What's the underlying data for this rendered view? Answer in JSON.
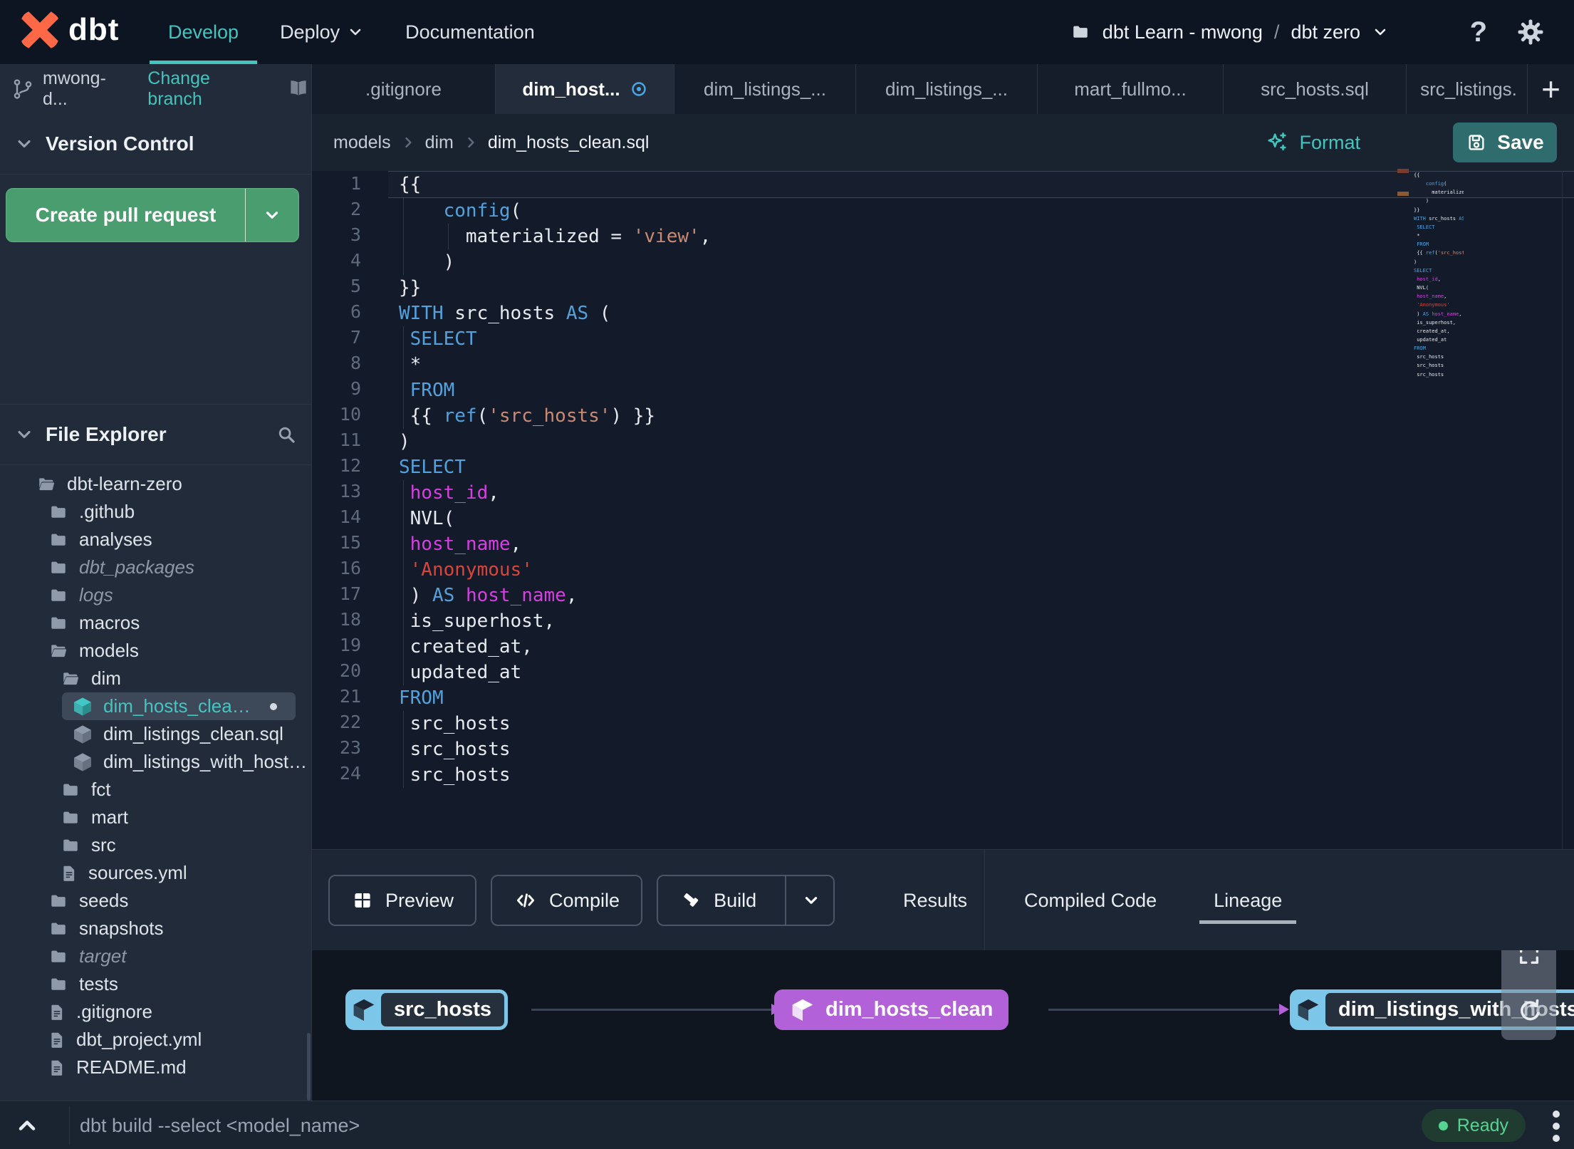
{
  "topnav": {
    "brand": "dbt",
    "items": [
      {
        "label": "Develop",
        "active": true,
        "chevron": false
      },
      {
        "label": "Deploy",
        "active": false,
        "chevron": true
      },
      {
        "label": "Documentation",
        "active": false,
        "chevron": false
      }
    ],
    "project": {
      "name": "dbt Learn - mwong",
      "separator": "/",
      "environment": "dbt zero"
    }
  },
  "branch": {
    "name": "mwong-d...",
    "action": "Change branch"
  },
  "tabs": [
    {
      "label": ".gitignore",
      "active": false,
      "dirty": false
    },
    {
      "label": "dim_host...",
      "active": true,
      "dirty": true
    },
    {
      "label": "dim_listings_...",
      "active": false,
      "dirty": false
    },
    {
      "label": "dim_listings_...",
      "active": false,
      "dirty": false
    },
    {
      "label": "mart_fullmo...",
      "active": false,
      "dirty": false
    },
    {
      "label": "src_hosts.sql",
      "active": false,
      "dirty": false
    },
    {
      "label": "src_listings.",
      "active": false,
      "dirty": false
    }
  ],
  "version_control": {
    "title": "Version Control",
    "create_pr_label": "Create pull request"
  },
  "file_explorer": {
    "title": "File Explorer",
    "tree": [
      {
        "label": "dbt-learn-zero",
        "icon": "folder-open",
        "depth": 0
      },
      {
        "label": ".github",
        "icon": "folder",
        "depth": 1
      },
      {
        "label": "analyses",
        "icon": "folder",
        "depth": 1
      },
      {
        "label": "dbt_packages",
        "icon": "folder",
        "depth": 1,
        "italic": true
      },
      {
        "label": "logs",
        "icon": "folder",
        "depth": 1,
        "italic": true
      },
      {
        "label": "macros",
        "icon": "folder",
        "depth": 1
      },
      {
        "label": "models",
        "icon": "folder-open",
        "depth": 1
      },
      {
        "label": "dim",
        "icon": "folder-open",
        "depth": 2
      },
      {
        "label": "dim_hosts_clean.sql",
        "icon": "model",
        "depth": 3,
        "selected": true,
        "modified": true
      },
      {
        "label": "dim_listings_clean.sql",
        "icon": "model",
        "depth": 3
      },
      {
        "label": "dim_listings_with_hosts...",
        "icon": "model",
        "depth": 3
      },
      {
        "label": "fct",
        "icon": "folder",
        "depth": 2
      },
      {
        "label": "mart",
        "icon": "folder",
        "depth": 2
      },
      {
        "label": "src",
        "icon": "folder",
        "depth": 2
      },
      {
        "label": "sources.yml",
        "icon": "file",
        "depth": 2
      },
      {
        "label": "seeds",
        "icon": "folder",
        "depth": 1
      },
      {
        "label": "snapshots",
        "icon": "folder",
        "depth": 1
      },
      {
        "label": "target",
        "icon": "folder",
        "depth": 1,
        "italic": true
      },
      {
        "label": "tests",
        "icon": "folder",
        "depth": 1
      },
      {
        "label": ".gitignore",
        "icon": "file",
        "depth": 1
      },
      {
        "label": "dbt_project.yml",
        "icon": "file",
        "depth": 1
      },
      {
        "label": "README.md",
        "icon": "file",
        "depth": 1
      }
    ]
  },
  "breadcrumb": {
    "items": [
      "models",
      "dim",
      "dim_hosts_clean.sql"
    ]
  },
  "editor_actions": {
    "format_label": "Format",
    "save_label": "Save"
  },
  "code": {
    "lines": [
      {
        "n": 1,
        "cur": true,
        "t": [
          [
            "d",
            "{{"
          ]
        ]
      },
      {
        "n": 2,
        "g": [
          0
        ],
        "t": [
          [
            "d",
            "    "
          ],
          [
            "k",
            "config"
          ],
          [
            "d",
            "("
          ]
        ]
      },
      {
        "n": 3,
        "g": [
          0,
          4
        ],
        "t": [
          [
            "d",
            "      materialized = "
          ],
          [
            "s",
            "'view'"
          ],
          [
            "d",
            ","
          ]
        ]
      },
      {
        "n": 4,
        "g": [
          0
        ],
        "t": [
          [
            "d",
            "    )"
          ]
        ]
      },
      {
        "n": 5,
        "t": [
          [
            "d",
            "}}"
          ]
        ]
      },
      {
        "n": 6,
        "t": [
          [
            "k",
            "WITH"
          ],
          [
            "d",
            " src_hosts "
          ],
          [
            "k",
            "AS"
          ],
          [
            "d",
            " ("
          ]
        ]
      },
      {
        "n": 7,
        "g": [
          0
        ],
        "t": [
          [
            "d",
            " "
          ],
          [
            "k",
            "SELECT"
          ]
        ]
      },
      {
        "n": 8,
        "g": [
          0
        ],
        "t": [
          [
            "d",
            " *"
          ]
        ]
      },
      {
        "n": 9,
        "g": [
          0
        ],
        "t": [
          [
            "d",
            " "
          ],
          [
            "k",
            "FROM"
          ]
        ]
      },
      {
        "n": 10,
        "g": [
          0
        ],
        "t": [
          [
            "d",
            " {{ "
          ],
          [
            "k",
            "ref"
          ],
          [
            "d",
            "("
          ],
          [
            "s",
            "'src_hosts'"
          ],
          [
            "d",
            ") }}"
          ]
        ]
      },
      {
        "n": 11,
        "t": [
          [
            "d",
            ")"
          ]
        ]
      },
      {
        "n": 12,
        "t": [
          [
            "k",
            "SELECT"
          ]
        ]
      },
      {
        "n": 13,
        "g": [
          0
        ],
        "t": [
          [
            "d",
            " "
          ],
          [
            "v",
            "host_id"
          ],
          [
            "d",
            ","
          ]
        ]
      },
      {
        "n": 14,
        "g": [
          0
        ],
        "t": [
          [
            "d",
            " NVL("
          ]
        ]
      },
      {
        "n": 15,
        "g": [
          0
        ],
        "t": [
          [
            "d",
            " "
          ],
          [
            "v",
            "host_name"
          ],
          [
            "d",
            ","
          ]
        ]
      },
      {
        "n": 16,
        "g": [
          0
        ],
        "t": [
          [
            "d",
            " "
          ],
          [
            "r",
            "'Anonymous'"
          ]
        ]
      },
      {
        "n": 17,
        "g": [
          0
        ],
        "t": [
          [
            "d",
            " ) "
          ],
          [
            "k",
            "AS"
          ],
          [
            "d",
            " "
          ],
          [
            "v",
            "host_name"
          ],
          [
            "d",
            ","
          ]
        ]
      },
      {
        "n": 18,
        "g": [
          0
        ],
        "t": [
          [
            "d",
            " is_superhost,"
          ]
        ]
      },
      {
        "n": 19,
        "g": [
          0
        ],
        "t": [
          [
            "d",
            " created_at,"
          ]
        ]
      },
      {
        "n": 20,
        "g": [
          0
        ],
        "t": [
          [
            "d",
            " updated_at"
          ]
        ]
      },
      {
        "n": 21,
        "t": [
          [
            "k",
            "FROM"
          ]
        ]
      },
      {
        "n": 22,
        "g": [
          0
        ],
        "t": [
          [
            "d",
            " src_hosts"
          ]
        ]
      },
      {
        "n": 23,
        "g": [
          0
        ],
        "t": [
          [
            "d",
            " src_hosts"
          ]
        ]
      },
      {
        "n": 24,
        "g": [
          0
        ],
        "t": [
          [
            "d",
            " src_hosts"
          ]
        ]
      }
    ]
  },
  "bottom_panel": {
    "buttons": [
      {
        "label": "Preview",
        "icon": "table",
        "split": false
      },
      {
        "label": "Compile",
        "icon": "code",
        "split": false
      },
      {
        "label": "Build",
        "icon": "hammer",
        "split": true
      }
    ],
    "tabs": [
      {
        "label": "Results",
        "active": false
      },
      {
        "label": "Compiled Code",
        "active": false
      },
      {
        "label": "Lineage",
        "active": true
      }
    ]
  },
  "lineage": {
    "nodes": [
      {
        "label": "src_hosts",
        "style": "source"
      },
      {
        "label": "dim_hosts_clean",
        "style": "model"
      },
      {
        "label": "dim_listings_with_hosts",
        "style": "source"
      }
    ]
  },
  "statusbar": {
    "command": "dbt build --select <model_name>",
    "status": "Ready"
  },
  "colors": {
    "accent_teal": "#43c5bd",
    "green_button": "#4a9d6e",
    "save_teal": "#2e6c6d",
    "node_purple": "#b261d9",
    "node_blue": "#7cc7e9",
    "ready_green": "#57d391",
    "dirty_blue": "#4aa8e8",
    "keyword_blue": "#53a2dd",
    "string_salmon": "#c98a74",
    "variable_magenta": "#d63fe0",
    "error_red": "#d9453a",
    "logo_orange": "#ff6847"
  }
}
